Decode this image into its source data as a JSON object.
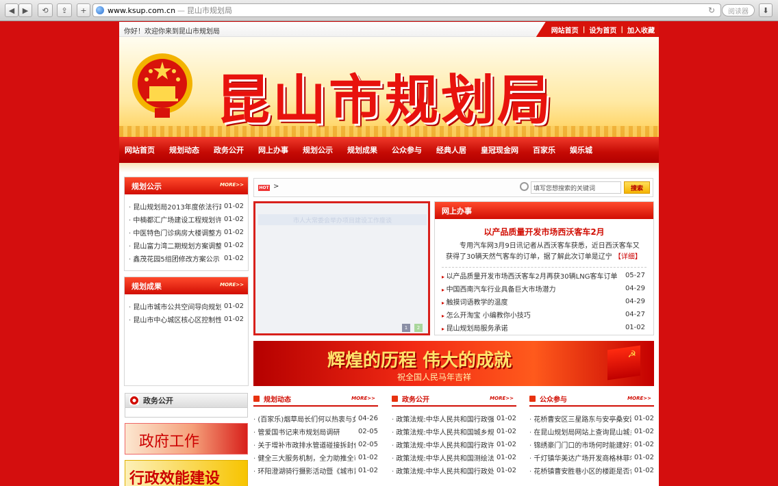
{
  "browser": {
    "url_host": "www.ksup.com.cn",
    "url_sep": "—",
    "page_title": "昆山市规划局",
    "search_placeholder": "阅读器"
  },
  "topbar": {
    "welcome": "你好！欢迎你来到昆山市规划局",
    "links": [
      "网站首页",
      "设为首页",
      "加入收藏"
    ],
    "sep": "|"
  },
  "banner": {
    "title": "昆山市规划局"
  },
  "nav": [
    "网站首页",
    "规划动态",
    "政务公开",
    "网上办事",
    "规划公示",
    "规划成果",
    "公众参与",
    "经典人居",
    "皇冠现金网",
    "百家乐",
    "娱乐城"
  ],
  "more_label": "MORE>>",
  "left": {
    "gongshi": {
      "title": "规划公示",
      "items": [
        {
          "t": "昆山规划局2013年度依法行政",
          "d": "01-02"
        },
        {
          "t": "中楠都汇广场建设工程规划许",
          "d": "01-02"
        },
        {
          "t": "中医特色门诊病房大楼调整方",
          "d": "01-02"
        },
        {
          "t": "昆山富力湾二期规划方案调整",
          "d": "01-02"
        },
        {
          "t": "鑫茂花园5组团修改方案公示",
          "d": "01-02"
        }
      ]
    },
    "chengguo": {
      "title": "规划成果",
      "items": [
        {
          "t": "昆山市城市公共空间导向规划",
          "d": "01-02"
        },
        {
          "t": "昆山市中心城区核心区控制性",
          "d": "01-02"
        }
      ]
    },
    "zhengwu": {
      "title": "政务公开"
    },
    "ad1": "政府工作",
    "ad2": "行政效能建设"
  },
  "search": {
    "hot": "HOT",
    "arrow": ">",
    "placeholder": "填写您想搜索的关键词",
    "button": "搜索"
  },
  "slideshow": {
    "caption": "市人大常委会举办项目建设工作座谈",
    "dots": [
      "1",
      "2"
    ]
  },
  "feature": {
    "title": "网上办事",
    "headline": "以产品质量开发市场西沃客车2月",
    "desc": "专用汽车网3月9日讯记者从西沃客车获悉，近日西沃客车又获得了30辆天然气客车的订单，据了解此次订单是辽宁",
    "detail_link": "【详细】",
    "items": [
      {
        "t": "以产品质量开发市场西沃客车2月再获30辆LNG客车订单",
        "d": "05-27"
      },
      {
        "t": "中国西南汽车行业具备巨大市场潜力",
        "d": "04-29"
      },
      {
        "t": "触摸词语教学的温度",
        "d": "04-29"
      },
      {
        "t": "怎么开淘宝 小编教你小技巧",
        "d": "04-27"
      },
      {
        "t": "昆山规划局服务承诺",
        "d": "01-02"
      }
    ]
  },
  "bigbanner": {
    "title": "辉煌的历程 伟大的成就",
    "sub": "祝全国人民马年吉祥"
  },
  "columns": [
    {
      "title": "规划动态",
      "items": [
        {
          "t": "(百家乐)烟草局长们何以热衷与女",
          "d": "04-26"
        },
        {
          "t": "管爱国书记来市规划局调研",
          "d": "02-05"
        },
        {
          "t": "关于增补市政排水管道碰接拆封作",
          "d": "02-05"
        },
        {
          "t": "健全三大服务机制，全力助推全市",
          "d": "01-02"
        },
        {
          "t": "环阳澄湖骑行摄影活动暨《城市昆",
          "d": "01-02"
        }
      ]
    },
    {
      "title": "政务公开",
      "items": [
        {
          "t": "政策法规:中华人民共和国行政强",
          "d": "01-02"
        },
        {
          "t": "政策法规:中华人民共和国城乡规",
          "d": "01-02"
        },
        {
          "t": "政策法规:中华人民共和国行政许",
          "d": "01-02"
        },
        {
          "t": "政策法规:中华人民共和国测绘法",
          "d": "01-02"
        },
        {
          "t": "政策法规:中华人民共和国行政处",
          "d": "01-02"
        }
      ]
    },
    {
      "title": "公众参与",
      "items": [
        {
          "t": "花桥曹安区三星路东与安亭桑安路",
          "d": "01-02"
        },
        {
          "t": "在昆山规划局网站上查询昆山城乡",
          "d": "01-02"
        },
        {
          "t": "锦绣豪门门口的市场何时能建好?",
          "d": "01-02"
        },
        {
          "t": "千灯镇华美达广场开发商格林菲尔",
          "d": "01-02"
        },
        {
          "t": "花桥镇曹安胜巷小区的楼距是否合",
          "d": "01-02"
        }
      ]
    }
  ]
}
